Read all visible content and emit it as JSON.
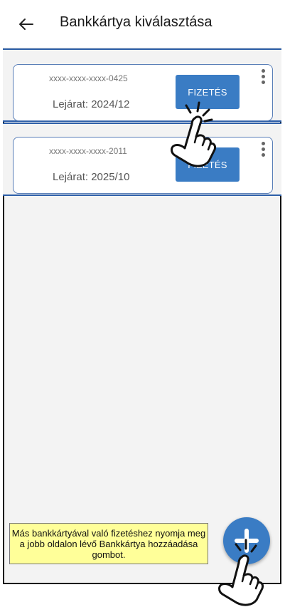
{
  "header": {
    "title": "Bankkártya kiválasztása",
    "back_icon": "arrow-left-icon"
  },
  "cards": [
    {
      "number": "xxxx-xxxx-xxxx-0425",
      "expiry": "Lejárat: 2024/12",
      "pay_label": "FIZETÉS"
    },
    {
      "number": "xxxx-xxxx-xxxx-2011",
      "expiry": "Lejárat: 2025/10",
      "pay_label": "FIZETÉS"
    }
  ],
  "hint": {
    "text": "Más bankkártyával való fizetéshez nyomja meg a jobb oldalon lévő Bankkártya hozzáadása gombot."
  },
  "colors": {
    "accent": "#3a7cc4",
    "hint_bg": "#ffff99",
    "band_border": "#2c5ea8"
  },
  "icons": {
    "fab": "plus-icon",
    "pointer": "hand-pointer-icon"
  }
}
